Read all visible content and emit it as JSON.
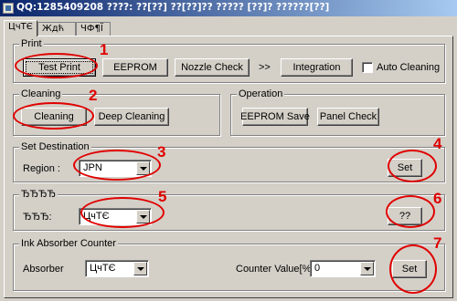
{
  "window": {
    "title": "QQ:1285409208 ????: ??[??] ??[??]?? ????? [??]? ??????[??]"
  },
  "tabs": [
    "ЦчТЄ",
    "Ждћ",
    "ЧФ¶Ї"
  ],
  "print_group": {
    "label": "Print",
    "test_print": "Test Print",
    "eeprom": "EEPROM",
    "nozzle_check": "Nozzle Check",
    "arrows": ">>",
    "integration": "Integration",
    "auto_cleaning": "Auto Cleaning"
  },
  "cleaning_group": {
    "label": "Cleaning",
    "cleaning": "Cleaning",
    "deep_cleaning": "Deep Cleaning"
  },
  "operation_group": {
    "label": "Operation",
    "eeprom_save": "EEPROM Save",
    "panel_check": "Panel Check"
  },
  "destination_group": {
    "label": "Set Destination",
    "region_label": "Region :",
    "region_value": "JPN",
    "set": "Set"
  },
  "unknown_group": {
    "label": "ЂЂЂЂ",
    "field_label": "ЂЂЂ:",
    "field_value": "ЦчТЄ",
    "button": "??"
  },
  "ink_group": {
    "label": "Ink Absorber Counter",
    "absorber_label": "Absorber",
    "absorber_value": "ЦчТЄ",
    "counter_label": "Counter Value[%]",
    "counter_value": "0",
    "set": "Set"
  },
  "annotations": [
    "1",
    "2",
    "3",
    "4",
    "5",
    "6",
    "7"
  ],
  "colors": {
    "annotation": "#e00000",
    "titlebar_start": "#0a246a",
    "titlebar_end": "#a6caf0",
    "face": "#d4d0c8"
  }
}
